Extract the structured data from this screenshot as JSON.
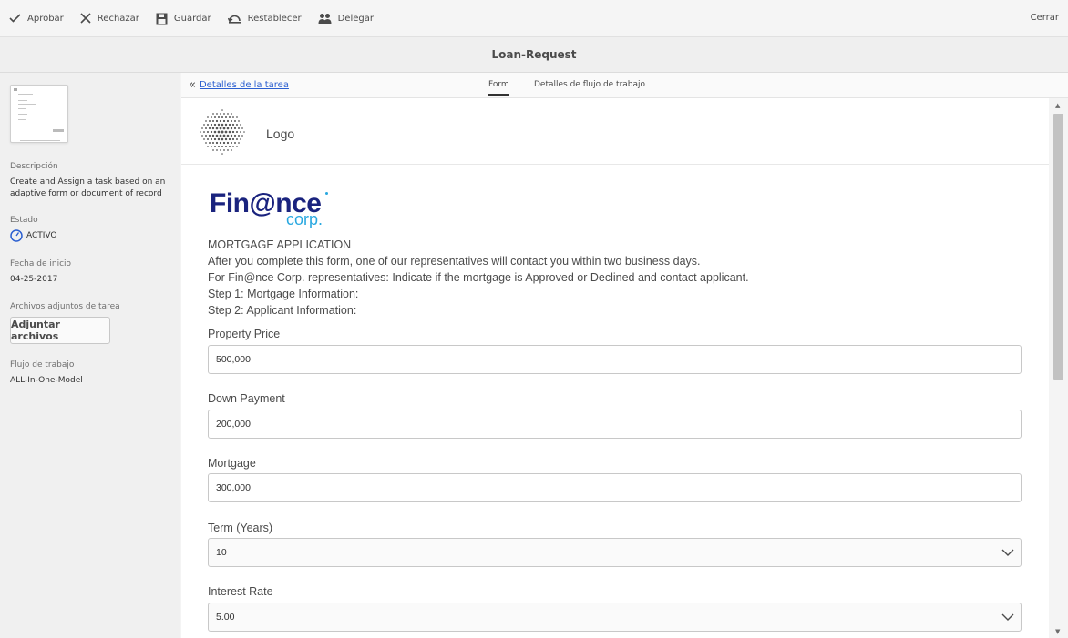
{
  "toolbar": {
    "approve": "Aprobar",
    "reject": "Rechazar",
    "save": "Guardar",
    "reset": "Restablecer",
    "delegate": "Delegar",
    "close": "Cerrar"
  },
  "title": "Loan-Request",
  "sidebar": {
    "description_label": "Descripción",
    "description_value": "Create and Assign a task based on an adaptive form or document of record",
    "status_label": "Estado",
    "status_value": "ACTIVO",
    "start_date_label": "Fecha de inicio",
    "start_date_value": "04-25-2017",
    "attachments_label": "Archivos adjuntos de tarea",
    "attach_button": "Adjuntar archivos",
    "workflow_label": "Flujo de trabajo",
    "workflow_value": "ALL-In-One-Model"
  },
  "tabs": {
    "back_link": "Detalles de la tarea",
    "form": "Form",
    "workflow_details": "Detalles de flujo de trabajo"
  },
  "form": {
    "logo_label": "Logo",
    "brand_main": "Fin@nce",
    "brand_sub": "corp.",
    "heading": "MORTGAGE APPLICATION",
    "intro_line1": "After you complete this form, one of our representatives will contact you within two business days.",
    "intro_line2": "For Fin@nce Corp. representatives: Indicate if the mortgage is Approved or Declined and contact applicant.",
    "step1": "Step 1: Mortgage Information:",
    "step2": "Step 2: Applicant Information:",
    "fields": [
      {
        "label": "Property Price",
        "value": "500,000"
      },
      {
        "label": "Down Payment",
        "value": "200,000"
      },
      {
        "label": "Mortgage",
        "value": "300,000"
      },
      {
        "label": "Term (Years)",
        "value": "10"
      },
      {
        "label": "Interest Rate",
        "value": "5.00"
      }
    ]
  },
  "colors": {
    "accent": "#2b5fd0",
    "brand_navy": "#1a237e",
    "brand_cyan": "#29a8e0"
  }
}
